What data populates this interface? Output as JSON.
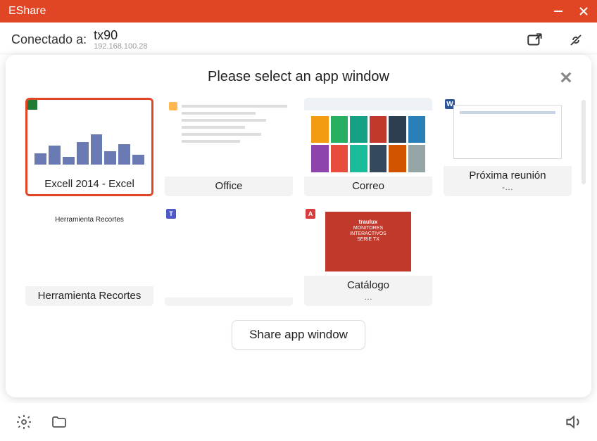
{
  "app": {
    "title": "EShare"
  },
  "connection": {
    "label": "Conectado a:",
    "device": "tx90",
    "ip": "192.168.100.28"
  },
  "overlay": {
    "title": "Please select an app window",
    "share_button": "Share app window",
    "tiles": [
      {
        "id": "excel",
        "label": "Excell 2014 - Excel",
        "sub": "",
        "selected": true
      },
      {
        "id": "office",
        "label": "Office",
        "sub": "",
        "selected": false
      },
      {
        "id": "correo",
        "label": "Correo",
        "sub": "",
        "selected": false
      },
      {
        "id": "reunion",
        "label": "Próxima reunión",
        "sub": "-…",
        "selected": false
      },
      {
        "id": "snip",
        "label": "Herramienta Recortes",
        "sub": "",
        "selected": false
      },
      {
        "id": "blank",
        "label": "",
        "sub": "",
        "selected": false
      },
      {
        "id": "catalogo",
        "label": "Catálogo",
        "sub": "…",
        "selected": false
      }
    ]
  },
  "thumb_labels": {
    "snip_inner": "Herramienta Recortes",
    "catalog_brand": "traulux",
    "catalog_line1": "MONITORES",
    "catalog_line2": "INTERACTIVOS",
    "catalog_line3": "SERIE TX"
  },
  "colors": {
    "brand": "#e04525"
  }
}
